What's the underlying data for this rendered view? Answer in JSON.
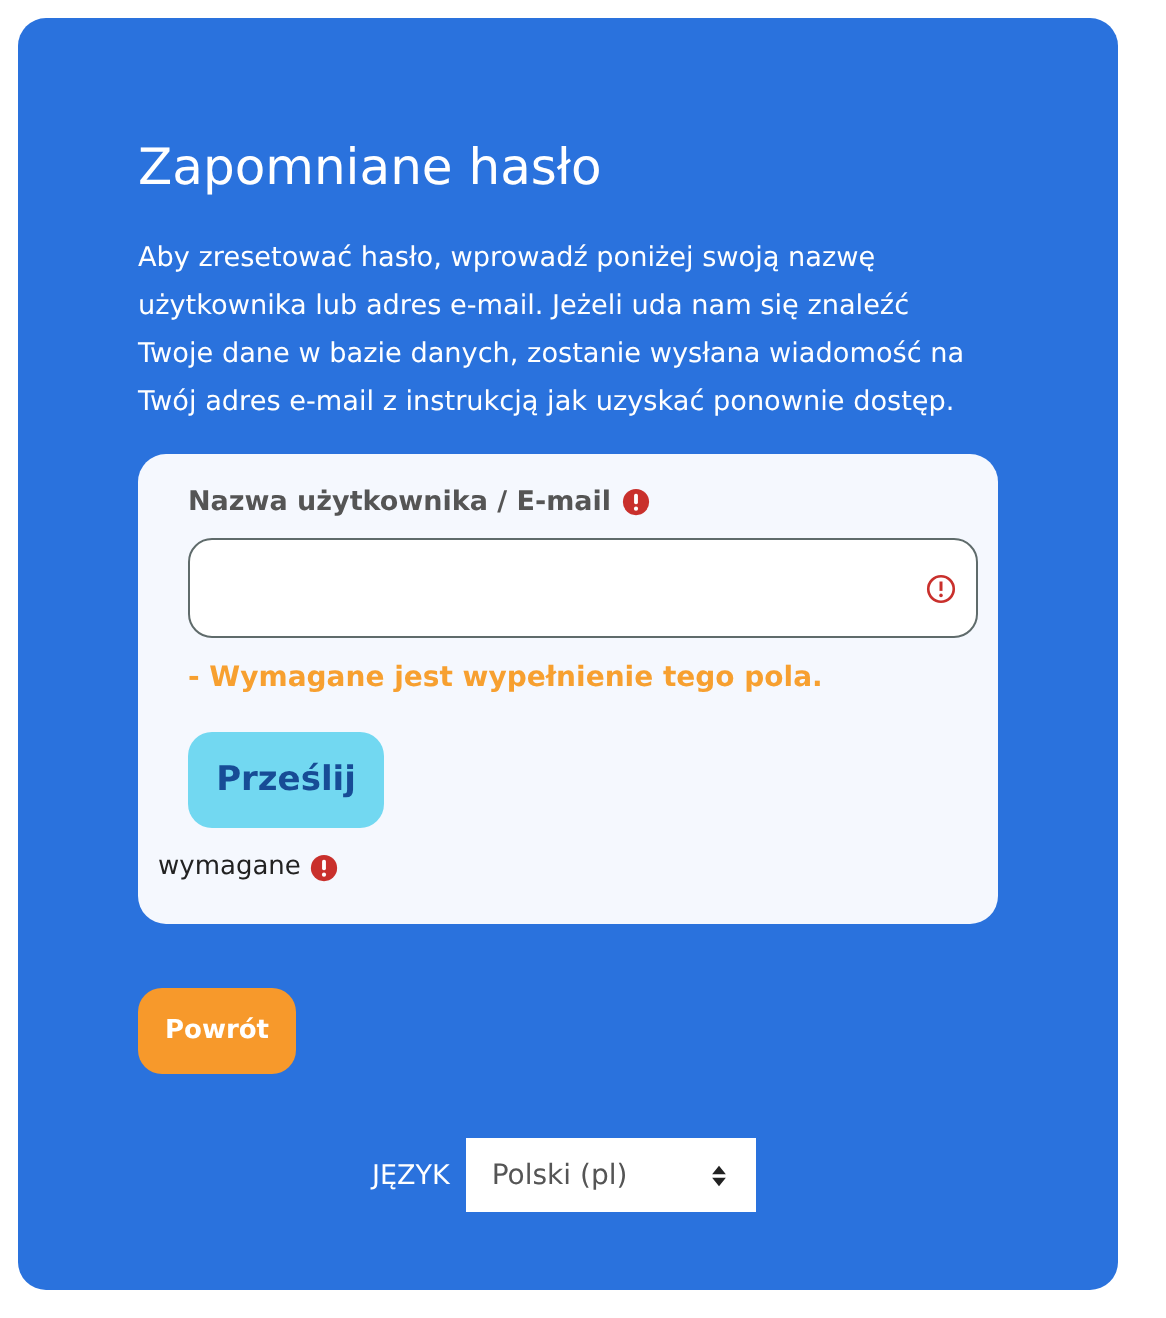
{
  "title": "Zapomniane hasło",
  "intro": "Aby zresetować hasło, wprowadź poniżej swoją nazwę użytkownika lub adres e-mail. Jeżeli uda nam się znaleźć Twoje dane w bazie danych, zostanie wysłana wiadomość na Twój adres e-mail z instrukcją jak uzyskać ponownie dostęp.",
  "form": {
    "field": {
      "label": "Nazwa użytkownika / E-mail",
      "required": true,
      "invalid": true,
      "error": "- Wymagane jest wypełnienie tego pola."
    },
    "submit": "Prześlij",
    "required_note": "wymagane"
  },
  "back_button": "Powrót",
  "language": {
    "label": "JĘZYK",
    "value": "Polski (pl)"
  }
}
